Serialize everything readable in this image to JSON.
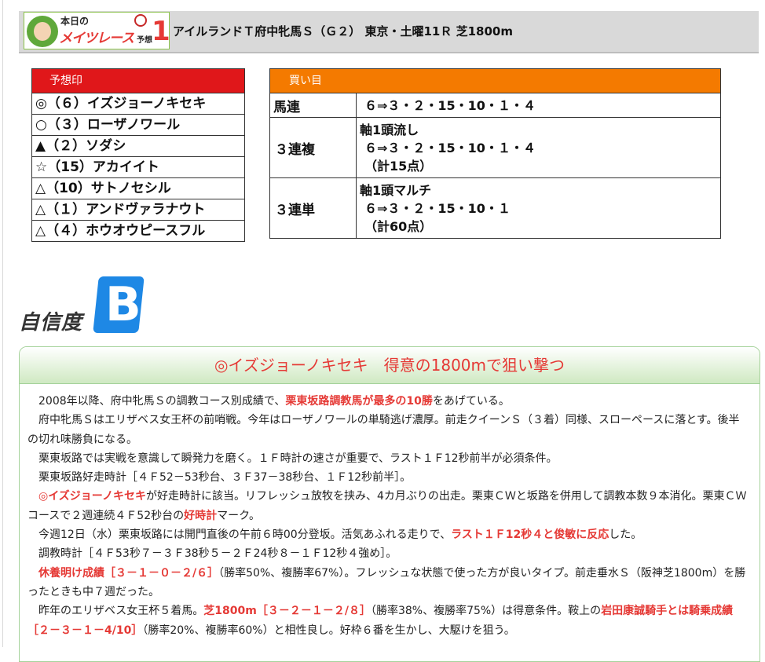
{
  "header": {
    "logo": {
      "line1": "本日の",
      "line2": "メイツレース",
      "line3": "予想",
      "number": "1"
    },
    "race_title": "アイルランドＴ府中牝馬Ｓ（Ｇ２） 東京・土曜11Ｒ 芝1800m"
  },
  "marks": {
    "title": "予想印",
    "items": [
      "◎（６）イズジョーノキセキ",
      "○（３）ローザノワール",
      "▲（２）ソダシ",
      "☆（15）アカイイト",
      "△（10）サトノセシル",
      "△（１）アンドヴァラナウト",
      "△（４）ホウオウピースフル"
    ]
  },
  "bets": {
    "title": "買い目",
    "rows": [
      {
        "type": "馬連",
        "lines": [
          "６⇒３・２・15・10・１・４"
        ]
      },
      {
        "type": "３連複",
        "lines": [
          "軸1頭流し",
          "６⇒３・２・15・10・１・４",
          "（計15点）"
        ]
      },
      {
        "type": "３連単",
        "lines": [
          "軸1頭マルチ",
          "６⇒３・２・15・10・１",
          "（計60点）"
        ]
      }
    ]
  },
  "confidence": {
    "label": "自信度",
    "grade": "B"
  },
  "analysis": {
    "title": "◎イズジョーノキセキ　得意の1800mで狙い撃つ",
    "paragraphs": [
      [
        {
          "t": "　2008年以降、府中牝馬Ｓの調教コース別成績で、"
        },
        {
          "t": "栗東坂路調教馬が最多の10勝",
          "r": true
        },
        {
          "t": "をあげている。"
        }
      ],
      [
        {
          "t": "　府中牝馬Ｓはエリザベス女王杯の前哨戦。今年はローザノワールの単騎逃げ濃厚。前走クイーンＳ（３着）同様、スローペースに落とす。後半の切れ味勝負になる。"
        }
      ],
      [
        {
          "t": "　栗東坂路では実戦を意識して瞬発力を磨く。１Ｆ時計の速さが重要で、ラスト１Ｆ12秒前半が必須条件。"
        }
      ],
      [
        {
          "t": "　栗東坂路好走時計［４Ｆ52－53秒台、３Ｆ37－38秒台、１Ｆ12秒前半］。"
        }
      ],
      [
        {
          "t": "　"
        },
        {
          "t": "◎イズジョーノキセキ",
          "r": true
        },
        {
          "t": "が好走時計に該当。リフレッシュ放牧を挟み、4カ月ぶりの出走。栗東ＣＷと坂路を併用して調教本数９本消化。栗東ＣＷコースで２週連続４Ｆ52秒台の"
        },
        {
          "t": "好時計",
          "r": true
        },
        {
          "t": "マーク。"
        }
      ],
      [
        {
          "t": "　今週12日（水）栗東坂路には開門直後の午前６時00分登坂。活気あふれる走りで、"
        },
        {
          "t": "ラスト１Ｆ12秒４と俊敏に反応",
          "r": true
        },
        {
          "t": "した。"
        }
      ],
      [
        {
          "t": "　調教時計［４Ｆ53秒７－３Ｆ38秒５－２Ｆ24秒８－１Ｆ12秒４強め］。"
        }
      ],
      [
        {
          "t": "　"
        },
        {
          "t": "休養明け成績［３－１－０－２/６］",
          "r": true
        },
        {
          "t": "（勝率50%、複勝率67%）。フレッシュな状態で使った方が良いタイプ。前走垂水Ｓ（阪神芝1800m）を勝ったときも中７週だった。"
        }
      ],
      [
        {
          "t": "　昨年のエリザベス女王杯５着馬。"
        },
        {
          "t": "芝1800m［３－２－１－２/８］",
          "r": true
        },
        {
          "t": "（勝率38%、複勝率75%）は得意条件。鞍上の"
        },
        {
          "t": "岩田康誠騎手とは騎乗成績［２－３－１－4/10］",
          "r": true
        },
        {
          "t": "（勝率20%、複勝率60%）と相性良し。好枠６番を生かし、大駆けを狙う。"
        }
      ]
    ]
  }
}
